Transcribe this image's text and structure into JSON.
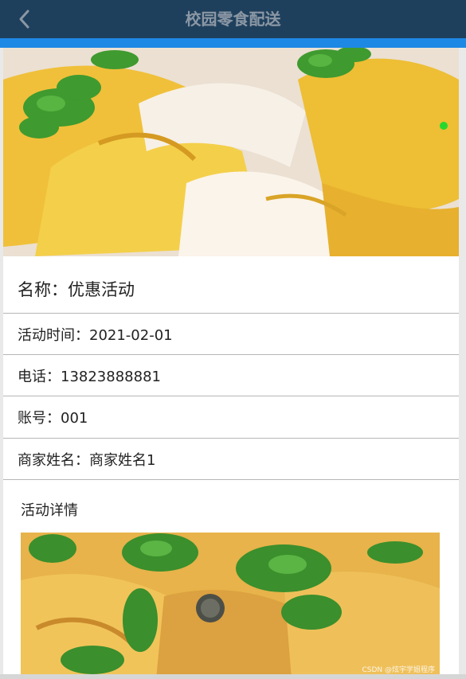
{
  "header": {
    "title": "校园零食配送",
    "back_icon": "chevron-left-icon"
  },
  "colors": {
    "header_bg": "#1f405d",
    "accent_bar": "#1e88e5",
    "carousel_dot": "#26d82e"
  },
  "activity": {
    "name": "名称：优惠活动",
    "time": "活动时间：2021-02-01",
    "phone": "电话：13823888881",
    "account": "账号：001",
    "merchant": "商家姓名：商家姓名1"
  },
  "details": {
    "title": "活动详情"
  },
  "watermark": "CSDN @炫宇学姐程序"
}
